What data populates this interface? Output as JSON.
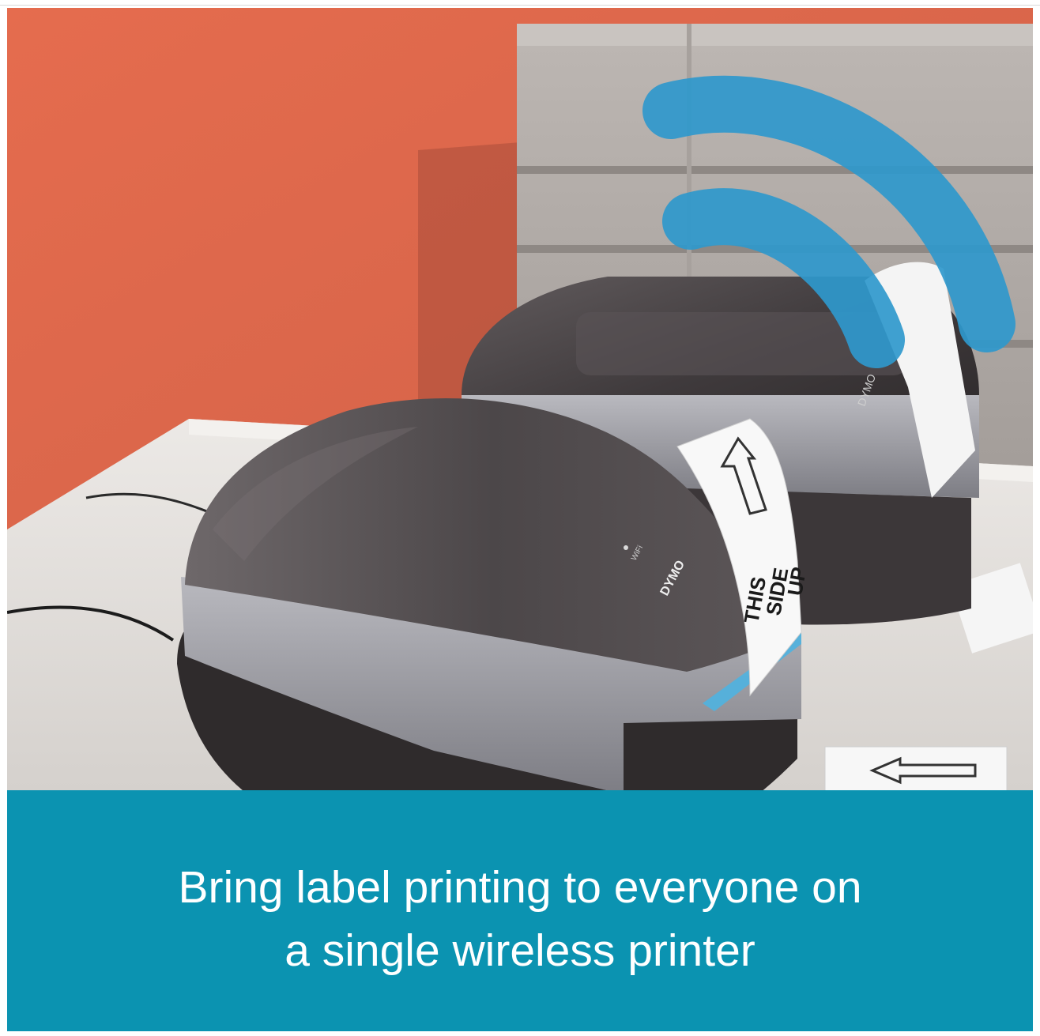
{
  "image": {
    "label_text_front": [
      "THIS",
      "SIDE",
      "UP"
    ],
    "brand_front": "DYMO",
    "brand_back": "DYMO",
    "wifi_label": "WiFi",
    "colors": {
      "wall": "#e36b4c",
      "printer_body": "#4a4547",
      "printer_trim": "#9a9aa0",
      "signal_arcs": "#2f98cc",
      "caption_band": "#0b93b1"
    }
  },
  "caption": {
    "line1": "Bring label printing to everyone on",
    "line2": "a single wireless printer"
  }
}
